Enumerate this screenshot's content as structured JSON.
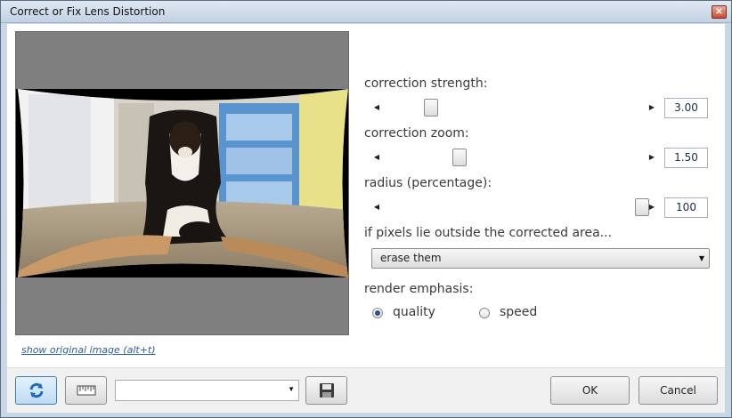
{
  "window": {
    "title": "Correct or Fix Lens Distortion",
    "close_icon": "close-icon"
  },
  "preview": {
    "show_original_link": "show original image (alt+t)"
  },
  "controls": {
    "strength": {
      "label": "correction strength:",
      "value": "3.00",
      "position_fraction": 0.18
    },
    "zoom": {
      "label": "correction zoom:",
      "value": "1.50",
      "position_fraction": 0.29
    },
    "radius": {
      "label": "radius (percentage):",
      "value": "100",
      "position_fraction": 0.99
    }
  },
  "outside": {
    "label": "if pixels lie outside the corrected area...",
    "selected": "erase them"
  },
  "render": {
    "label": "render emphasis:",
    "options": [
      {
        "label": "quality",
        "selected": true
      },
      {
        "label": "speed",
        "selected": false
      }
    ]
  },
  "footer": {
    "refresh_icon": "refresh-icon",
    "ruler_icon": "ruler-icon",
    "preset_combo_value": "",
    "save_icon": "save-preset-icon",
    "ok_label": "OK",
    "cancel_label": "Cancel"
  },
  "colors": {
    "accent": "#3c7fb1",
    "link": "#2a5ea8",
    "radio_dot": "#2c4f8c"
  }
}
